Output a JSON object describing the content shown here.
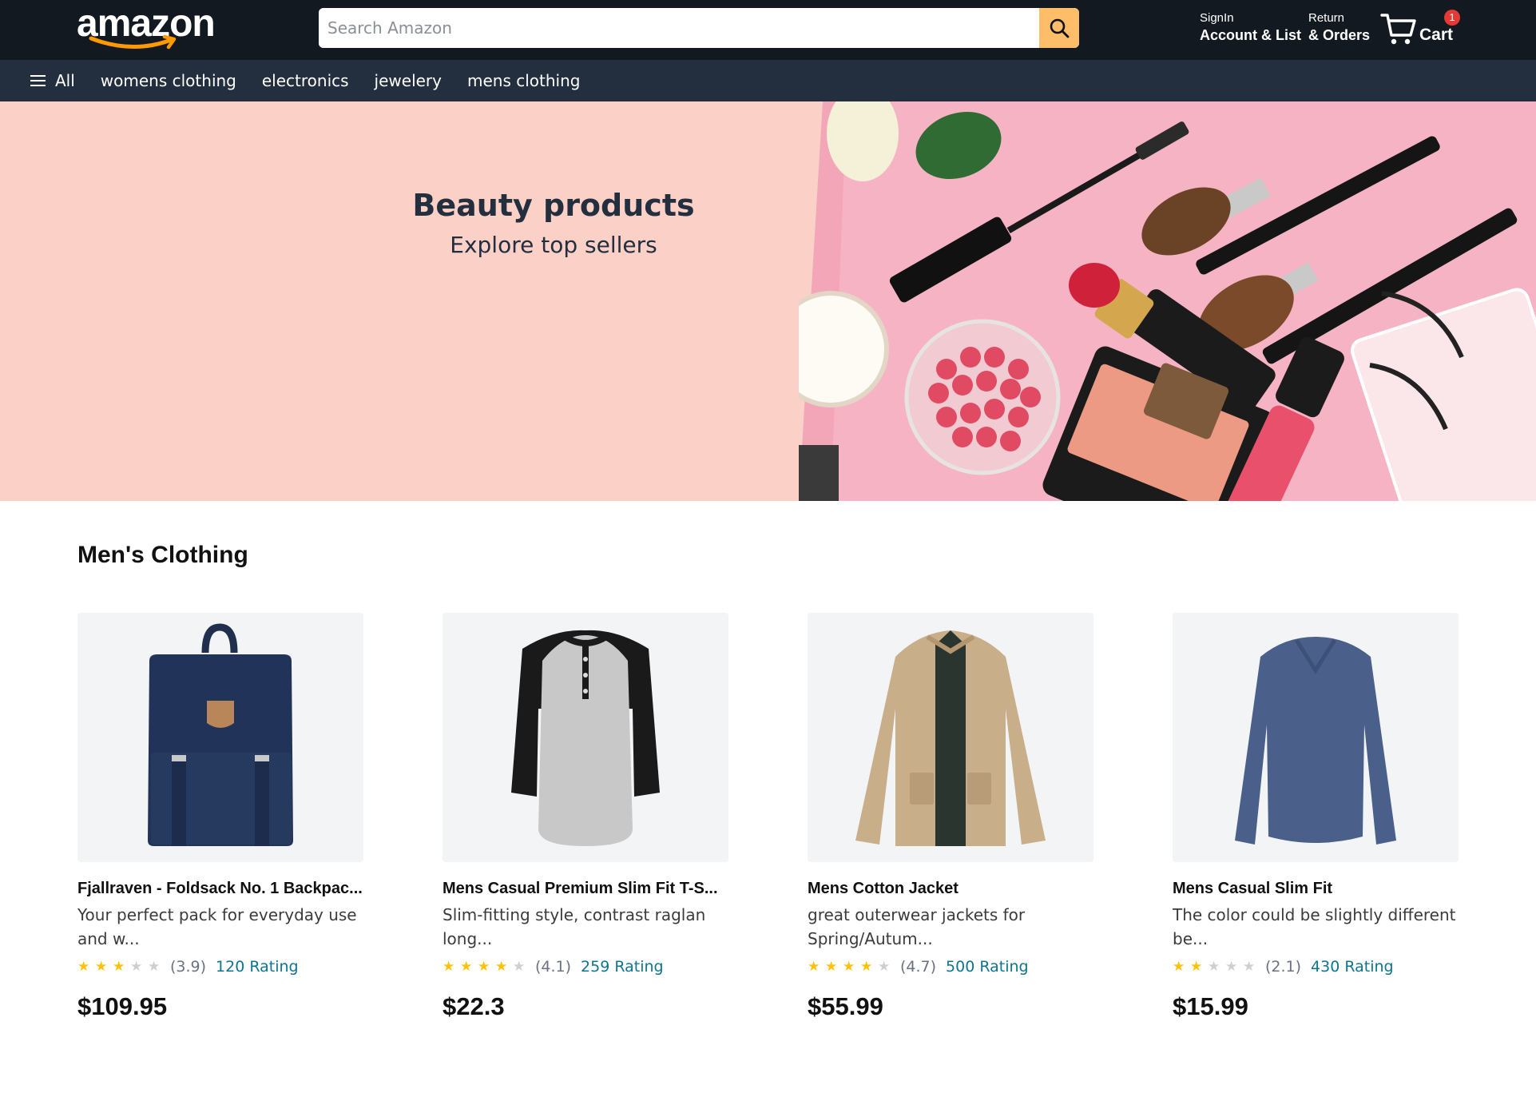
{
  "header": {
    "logo_text": "amazon",
    "search": {
      "placeholder": "Search Amazon",
      "value": "",
      "button_icon": "search-icon"
    },
    "account": {
      "small": "SignIn",
      "big": "Account & List"
    },
    "returns": {
      "small": "Return",
      "big": "& Orders"
    },
    "cart": {
      "label": "Cart",
      "count": "1",
      "icon": "cart-icon"
    },
    "colors": {
      "topbar": "#131921",
      "subnav": "#232f3e",
      "search_button": "#febd69",
      "badge": "#e53935"
    }
  },
  "subnav": {
    "all_label": "All",
    "links": [
      "womens clothing",
      "electronics",
      "jewelery",
      "mens clothing"
    ]
  },
  "hero": {
    "title": "Beauty products",
    "subtitle": "Explore top sellers",
    "background": "#fbd0c7"
  },
  "section": {
    "title": "Men's Clothing",
    "products": [
      {
        "title": "Fjallraven - Foldsack No. 1 Backpac...",
        "description": "Your perfect pack for everyday use and w...",
        "rating": "(3.9)",
        "rating_value": 3.9,
        "rating_count": "120 Rating",
        "price": "$109.95",
        "icon": "backpack-image"
      },
      {
        "title": "Mens Casual Premium Slim Fit T-S...",
        "description": "Slim-fitting style, contrast raglan long...",
        "rating": "(4.1)",
        "rating_value": 4.1,
        "rating_count": "259 Rating",
        "price": "$22.3",
        "icon": "raglan-shirt-image"
      },
      {
        "title": "Mens Cotton Jacket",
        "description": "great outerwear jackets for Spring/Autum...",
        "rating": "(4.7)",
        "rating_value": 4.7,
        "rating_count": "500 Rating",
        "price": "$55.99",
        "icon": "jacket-image"
      },
      {
        "title": "Mens Casual Slim Fit",
        "description": "The color could be slightly different be...",
        "rating": "(2.1)",
        "rating_value": 2.1,
        "rating_count": "430 Rating",
        "price": "$15.99",
        "icon": "long-sleeve-shirt-image"
      }
    ]
  }
}
